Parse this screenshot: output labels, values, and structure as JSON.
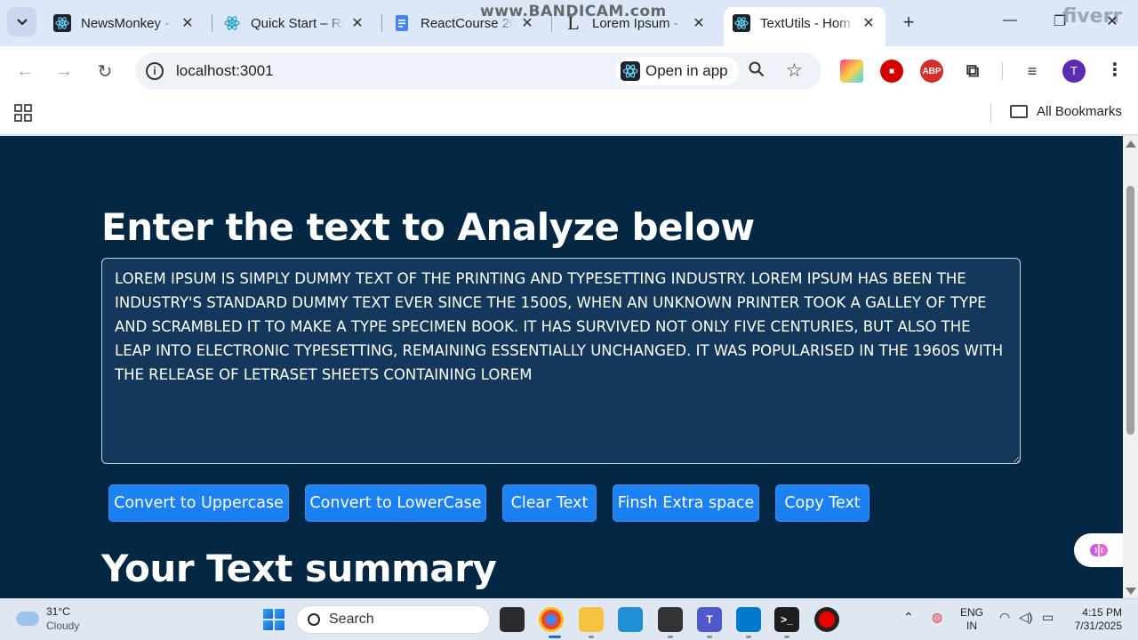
{
  "browser": {
    "tabs": [
      {
        "title": "NewsMonkey -",
        "icon": "react-icon"
      },
      {
        "title": "Quick Start – Re",
        "icon": "react-icon"
      },
      {
        "title": "ReactCourse 20",
        "icon": "google-docs-icon"
      },
      {
        "title": "Lorem Ipsum -",
        "icon": "lorem-ipsum-icon"
      },
      {
        "title": "TextUtils - Hom",
        "icon": "react-icon",
        "active": true
      }
    ],
    "url": "localhost:3001",
    "open_in_app": "Open in app",
    "profile_initial": "T",
    "all_bookmarks": "All Bookmarks",
    "watermark": "www.BANDICAM.com",
    "overlay_logo": "fiverr"
  },
  "page": {
    "heading": "Enter the text to Analyze below",
    "textarea_value": "LOREM IPSUM IS SIMPLY DUMMY TEXT OF THE PRINTING AND TYPESETTING INDUSTRY. LOREM IPSUM HAS BEEN THE INDUSTRY'S STANDARD DUMMY TEXT EVER SINCE THE 1500S, WHEN AN UNKNOWN PRINTER TOOK A GALLEY OF TYPE AND SCRAMBLED IT TO MAKE A TYPE SPECIMEN BOOK. IT HAS SURVIVED NOT ONLY FIVE CENTURIES, BUT ALSO THE LEAP INTO ELECTRONIC TYPESETTING, REMAINING ESSENTIALLY UNCHANGED. IT WAS POPULARISED IN THE 1960S WITH THE RELEASE OF LETRASET SHEETS CONTAINING LOREM",
    "buttons": {
      "uppercase": "Convert to Uppercase",
      "lowercase": "Convert to LowerCase",
      "clear": "Clear Text",
      "extra_space": "Finsh Extra space",
      "copy": "Copy Text"
    },
    "summary_heading": "Your Text summary",
    "colors": {
      "background": "#042743",
      "button": "#1a7ef0"
    }
  },
  "taskbar": {
    "weather_temp": "31°C",
    "weather_desc": "Cloudy",
    "search_placeholder": "Search",
    "lang_line1": "ENG",
    "lang_line2": "IN",
    "time": "4:15 PM",
    "date": "7/31/2025"
  }
}
